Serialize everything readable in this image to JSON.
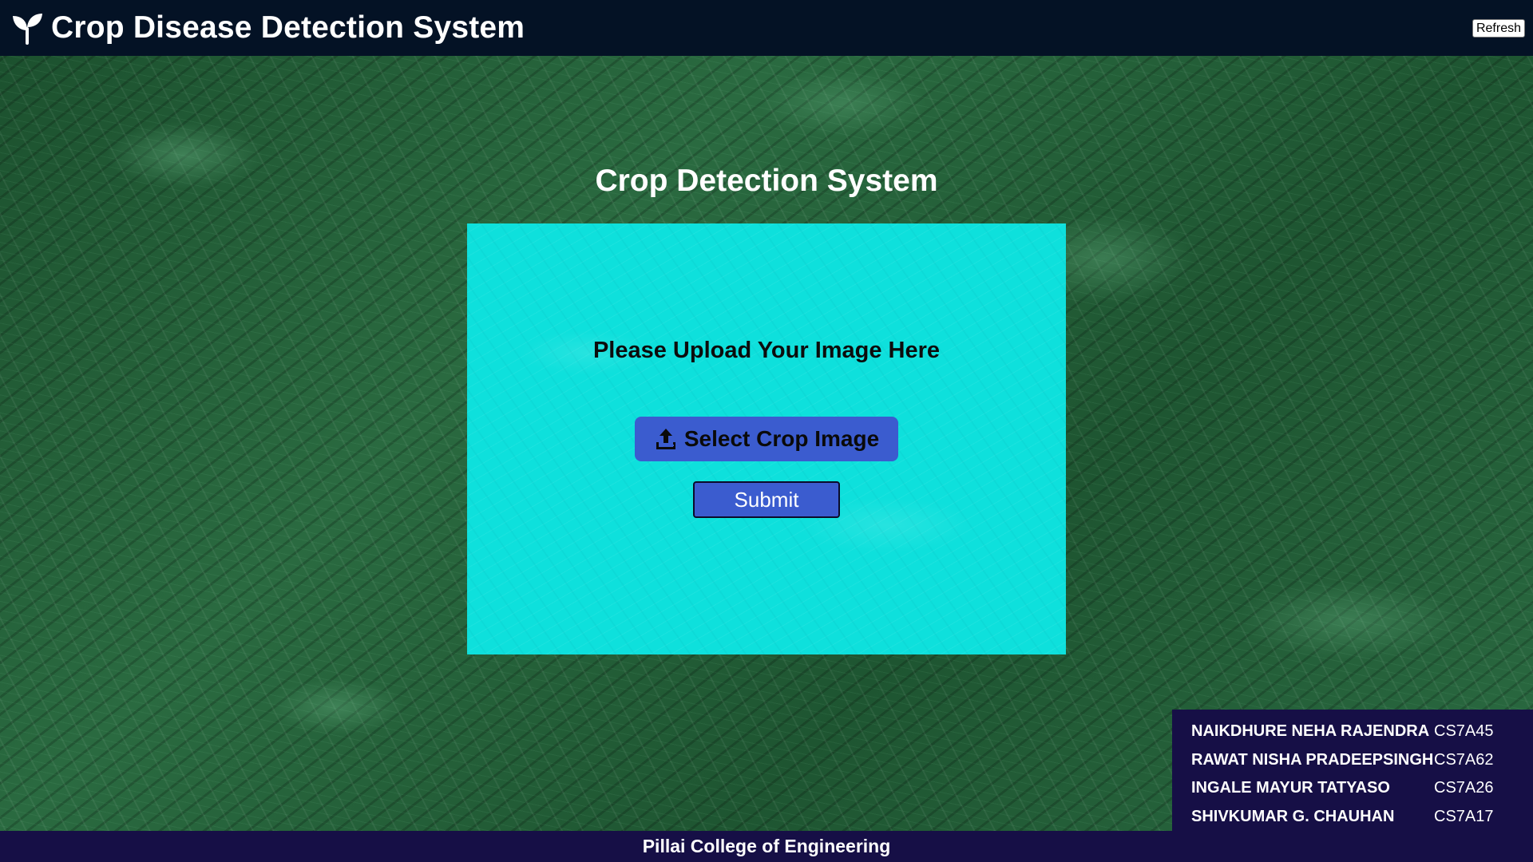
{
  "header": {
    "title": "Crop Disease Detection System",
    "logo_icon": "sprout-icon",
    "refresh_label": "Refresh"
  },
  "main": {
    "title": "Crop Detection System",
    "upload_prompt": "Please Upload Your Image Here",
    "select_button_label": "Select Crop Image",
    "select_button_icon": "upload-icon",
    "submit_label": "Submit"
  },
  "team": [
    {
      "name": "NAIKDHURE NEHA RAJENDRA",
      "id": "CS7A45"
    },
    {
      "name": "RAWAT NISHA PRADEEPSINGH",
      "id": "CS7A62"
    },
    {
      "name": "INGALE MAYUR TATYASO",
      "id": "CS7A26"
    },
    {
      "name": "SHIVKUMAR G. CHAUHAN",
      "id": "CS7A17"
    }
  ],
  "footer": {
    "text": "Pillai College of Engineering"
  },
  "colors": {
    "header_bg": "#041225",
    "card_bg": "#0ee0dc",
    "button_bg": "#3b5ccf",
    "panel_bg": "#160f46",
    "page_bg": "#1f5a34"
  }
}
